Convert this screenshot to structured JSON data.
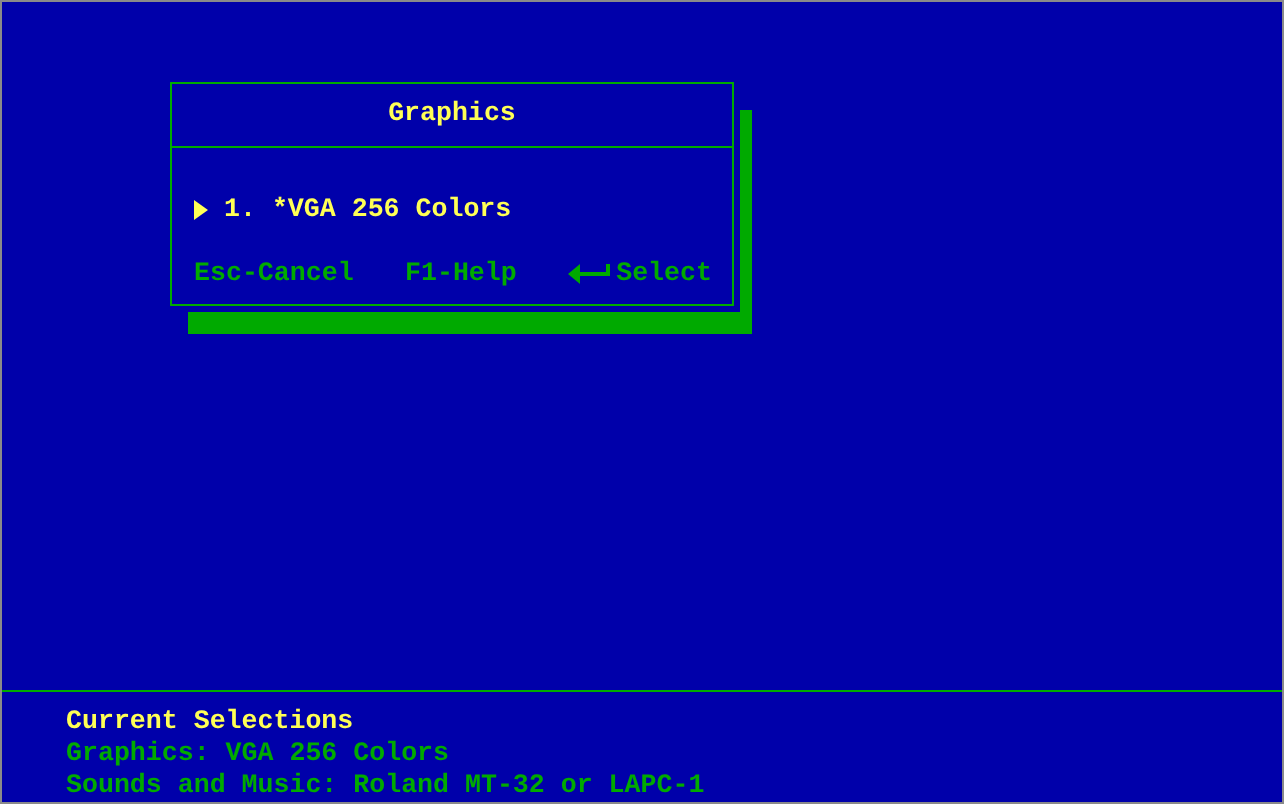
{
  "dialog": {
    "title": "Graphics",
    "items": [
      {
        "label": "1. *VGA 256 Colors",
        "selected": true
      }
    ],
    "hints": [
      {
        "kind": "text",
        "label": "Esc-Cancel"
      },
      {
        "kind": "text",
        "label": "F1-Help"
      },
      {
        "kind": "enter",
        "label": "Select"
      }
    ]
  },
  "current_selections": {
    "heading": "Current Selections",
    "lines": [
      "Graphics: VGA 256 Colors",
      "Sounds and Music: Roland MT-32 or LAPC-1"
    ]
  }
}
